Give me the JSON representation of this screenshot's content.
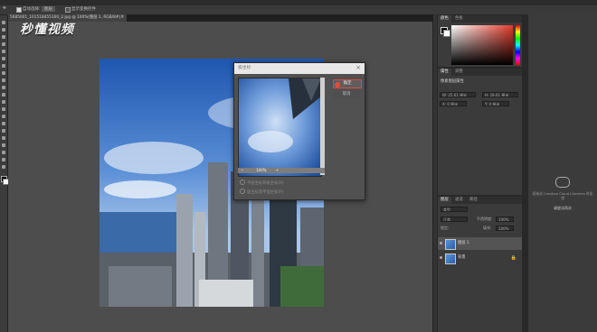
{
  "app": {
    "watermark": "秒懂视频"
  },
  "options_bar": {
    "auto_select_label": "自动选择:",
    "auto_select_value": "图层",
    "show_transform_label": "显示变换控件"
  },
  "document_tab": {
    "title": "5685001_101518455160_2.jpg @ 100%(图层 1, RGB/8#) *",
    "close": "×"
  },
  "dialog": {
    "title": "极坐标",
    "close": "×",
    "ok_label": "确定",
    "cancel_label": "取消",
    "zoom_value": "100%",
    "option1": "平面坐标到极坐标(R)",
    "option2": "极坐标到平面坐标(P)"
  },
  "color_panel": {
    "tabs": [
      "颜色",
      "色板"
    ]
  },
  "properties_panel": {
    "tabs": [
      "属性",
      "调整"
    ],
    "section_title": "像素图层属性",
    "w_value": "W: 25.61 厘米",
    "h_value": "H: 28.61 厘米",
    "x_value": "X: 0 厘米",
    "y_value": "Y: 0 厘米"
  },
  "layers_panel": {
    "tabs": [
      "图层",
      "通道",
      "路径"
    ],
    "kind_filter": "类型",
    "blend_mode": "正常",
    "opacity_label": "不透明度:",
    "opacity_value": "100%",
    "lock_label": "锁定:",
    "fill_label": "填充:",
    "fill_value": "100%",
    "layers": [
      {
        "name": "图层 1"
      },
      {
        "name": "背景"
      }
    ]
  },
  "libraries_panel": {
    "message": "初始化 Creative Cloud Libraries 时出错",
    "retry_label": "请尝试再次"
  },
  "colors": {
    "accent_ok": "#e24b3b",
    "panel_bg": "#3b3b3b",
    "canvas_bg": "#4d4d4d"
  }
}
